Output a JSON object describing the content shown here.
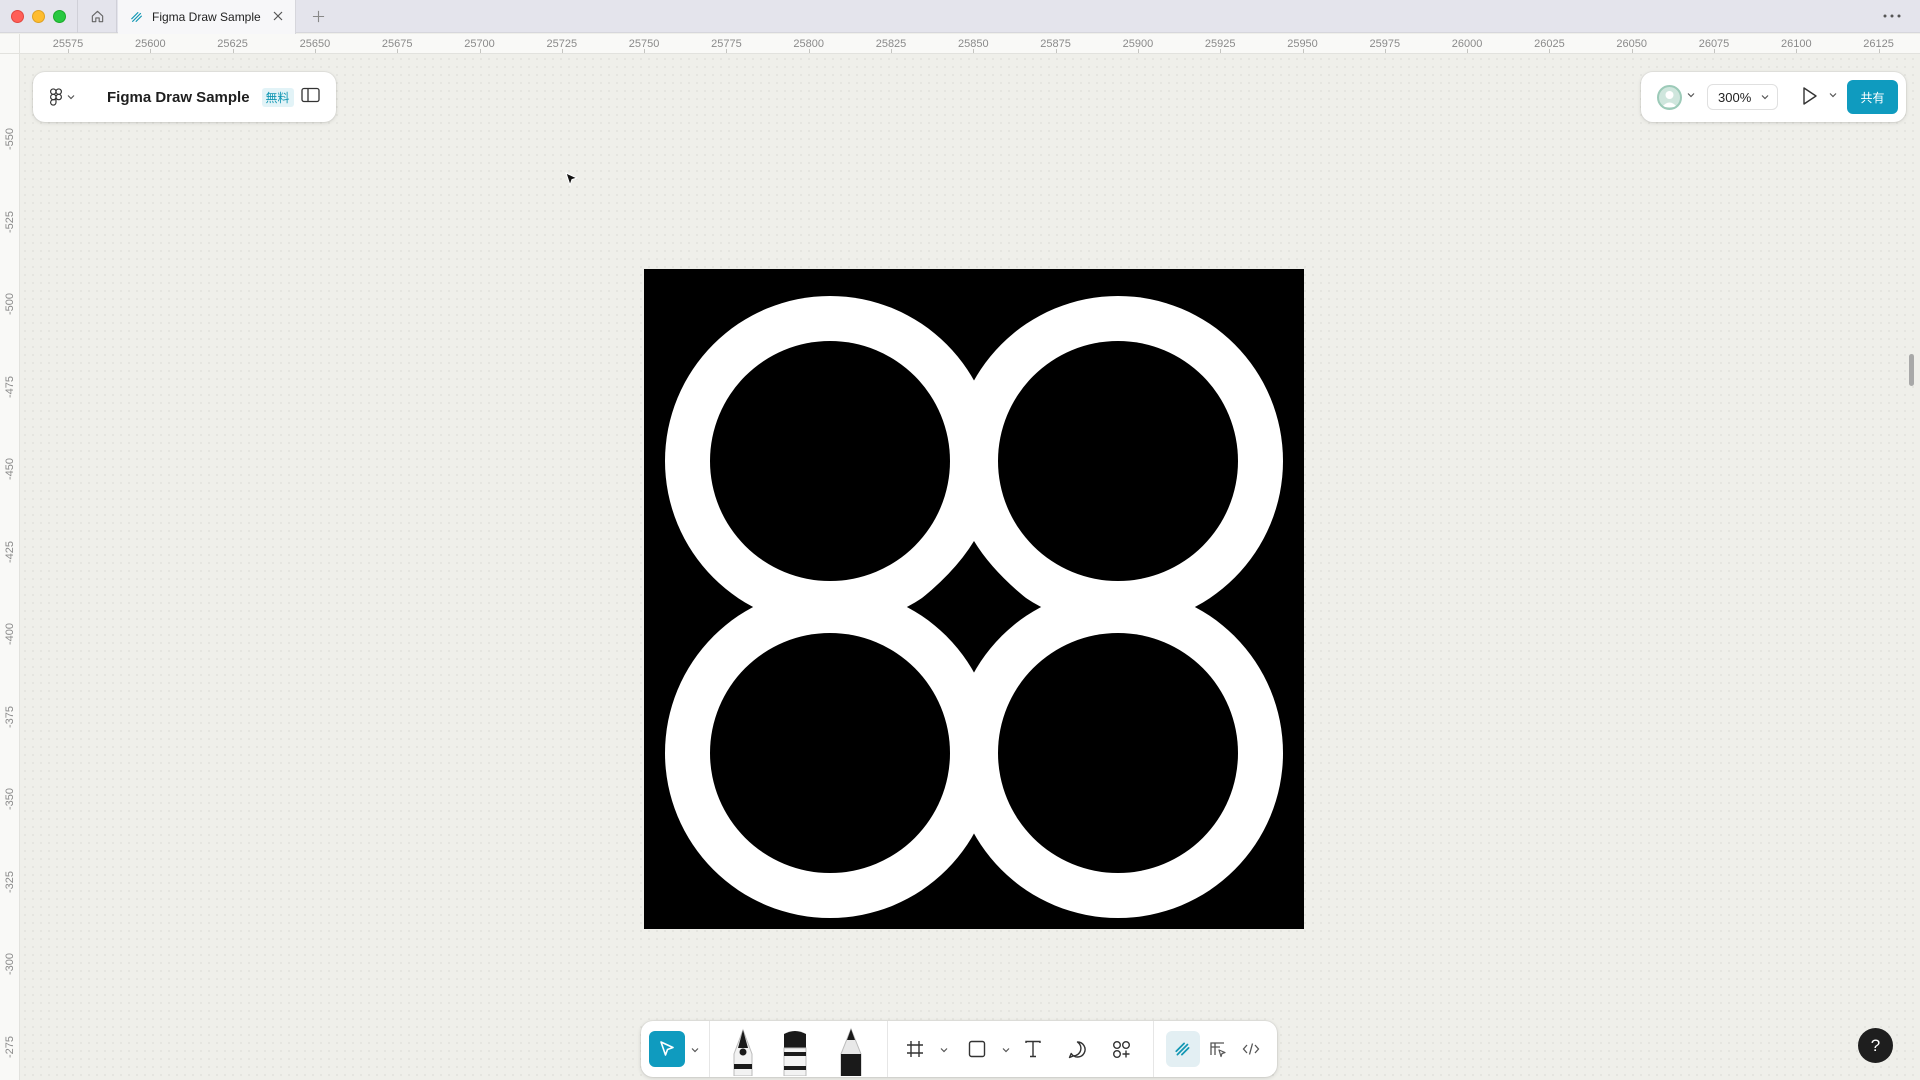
{
  "browser": {
    "tab_title": "Figma Draw Sample",
    "icons": {
      "home": "home-icon",
      "close": "close-icon",
      "add": "plus-icon",
      "more": "more-horizontal-icon"
    }
  },
  "rulers": {
    "top_ticks": [
      "25575",
      "25600",
      "25625",
      "25650",
      "25675",
      "25700",
      "25725",
      "25750",
      "25775",
      "25800",
      "25825",
      "25850",
      "25875",
      "25900",
      "25925",
      "25950",
      "25975",
      "26000",
      "26025",
      "26050",
      "26075",
      "26100",
      "26125"
    ],
    "left_ticks": [
      "-550",
      "-525",
      "-500",
      "-475",
      "-450",
      "-425",
      "-400",
      "-375",
      "-350",
      "-325",
      "-300",
      "-275"
    ]
  },
  "file_panel": {
    "file_name": "Figma Draw Sample",
    "plan_badge": "無料",
    "icons": {
      "menu": "figma-logo-icon",
      "sidebar": "sidebar-toggle-icon"
    }
  },
  "right_panel": {
    "zoom_level": "300%",
    "share_label": "共有",
    "icons": {
      "present": "play-icon",
      "avatar": "user-avatar-icon"
    }
  },
  "artwork": {
    "background_color": "#000000",
    "ring_color": "#ffffff",
    "shape": "four interlocking rings"
  },
  "toolbar": {
    "tools": [
      {
        "name": "move",
        "icon": "cursor-arrow-icon",
        "active": true
      },
      {
        "name": "pen",
        "icon": "pen-icon"
      },
      {
        "name": "brush",
        "icon": "brush-icon"
      },
      {
        "name": "pencil",
        "icon": "pencil-icon"
      },
      {
        "name": "frame",
        "icon": "frame-icon"
      },
      {
        "name": "rectangle",
        "icon": "rectangle-icon"
      },
      {
        "name": "text",
        "icon": "text-icon"
      },
      {
        "name": "comment",
        "icon": "comment-icon"
      },
      {
        "name": "actions",
        "icon": "actions-icon"
      },
      {
        "name": "draw-mode",
        "icon": "draw-mode-icon",
        "active": true
      },
      {
        "name": "design-mode",
        "icon": "design-mode-icon"
      },
      {
        "name": "dev-mode",
        "icon": "code-icon"
      }
    ]
  },
  "help": {
    "label": "?"
  },
  "colors": {
    "accent": "#0f9bbf",
    "canvas": "#efefea",
    "panel": "#ffffff"
  }
}
